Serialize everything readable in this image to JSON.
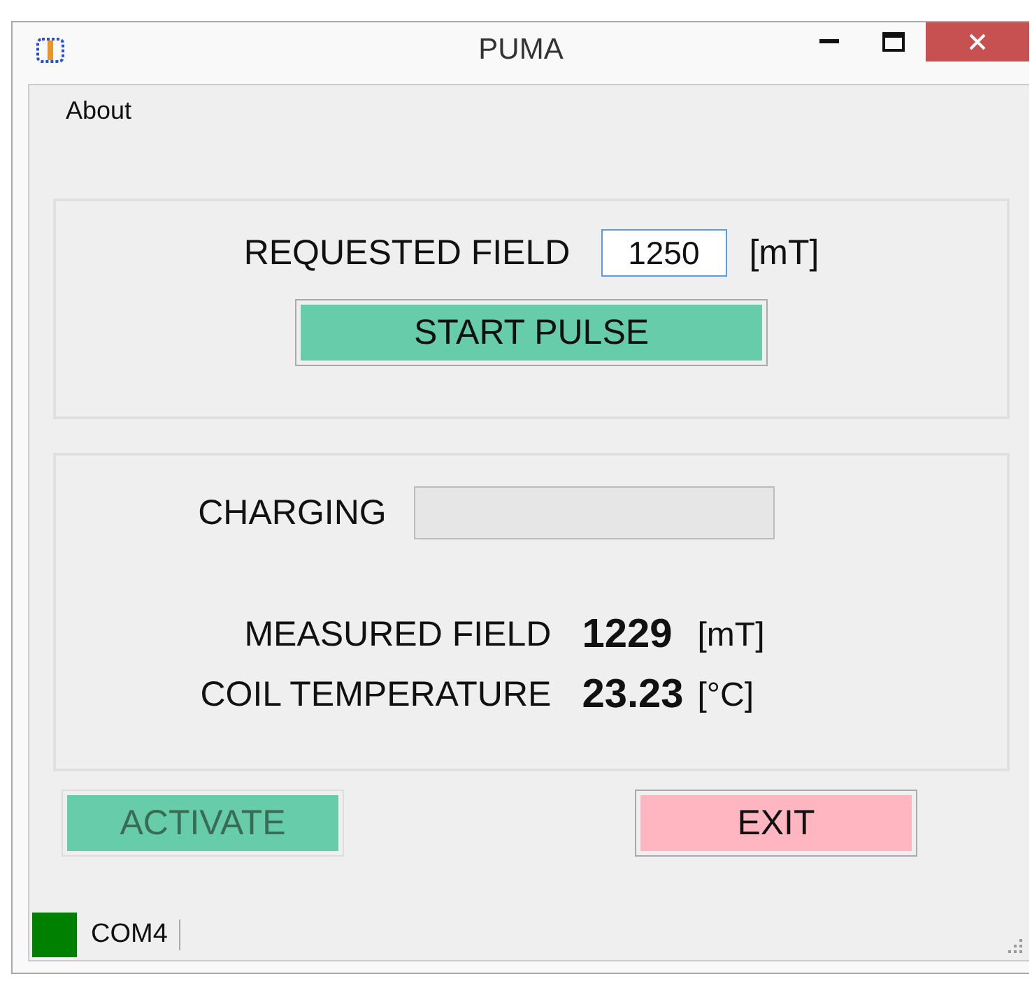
{
  "window": {
    "title": "PUMA"
  },
  "menu": [
    {
      "label": "About"
    }
  ],
  "request": {
    "label": "REQUESTED FIELD",
    "value": "1250",
    "unit": "[mT]",
    "button": "START PULSE"
  },
  "charging": {
    "label": "CHARGING",
    "level": 0
  },
  "readings": [
    {
      "label": "MEASURED FIELD",
      "value": "1229",
      "unit": "[mT]"
    },
    {
      "label": "COIL TEMPERATURE",
      "value": "23.23",
      "unit": "[°C]"
    }
  ],
  "buttons": [
    {
      "label": "ACTIVATE",
      "kind": "activate",
      "disabled": true
    },
    {
      "label": "EXIT",
      "kind": "exit",
      "disabled": false
    }
  ],
  "status_bar": {
    "port": "COM4",
    "color": "#008000"
  }
}
